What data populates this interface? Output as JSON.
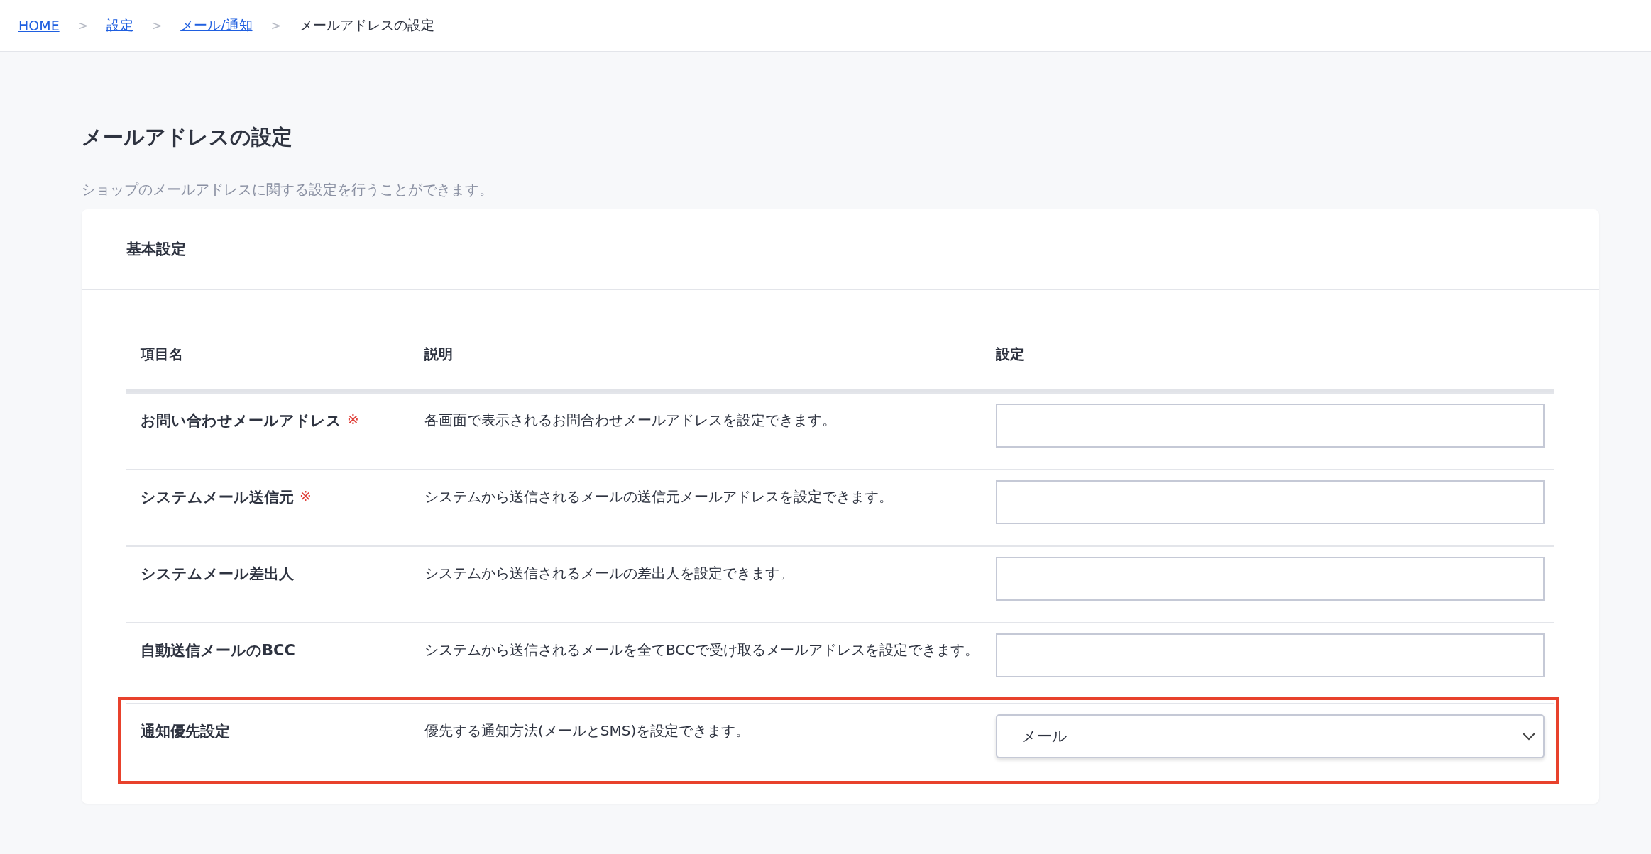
{
  "breadcrumb": [
    {
      "label": "HOME",
      "link": true
    },
    {
      "separator": ">",
      "label": "設定",
      "link": true
    },
    {
      "separator": ">",
      "label": "メール/通知",
      "link": true
    },
    {
      "separator": ">",
      "label": "メールアドレスの設定",
      "link": false
    }
  ],
  "page": {
    "title": "メールアドレスの設定",
    "description": "ショップのメールアドレスに関する設定を行うことができます。"
  },
  "card": {
    "title": "基本設定",
    "table": {
      "columns": [
        "項目名",
        "説明",
        "設定"
      ],
      "rows": [
        {
          "name": "お問い合わせメールアドレス",
          "required_mark": "※",
          "description": "各画面で表示されるお問合わせメールアドレスを設定できます。",
          "control": {
            "kind": "text"
          },
          "highlighted": false
        },
        {
          "name": "システムメール送信元",
          "required_mark": "※",
          "description": "システムから送信されるメールの送信元メールアドレスを設定できます。",
          "control": {
            "kind": "text"
          },
          "highlighted": false
        },
        {
          "name": "システムメール差出人",
          "description": "システムから送信されるメールの差出人を設定できます。",
          "control": {
            "kind": "text"
          },
          "highlighted": false
        },
        {
          "name": "自動送信メールのBCC",
          "description": "システムから送信されるメールを全てBCCで受け取るメールアドレスを設定できます。",
          "control": {
            "kind": "text"
          },
          "highlighted": false
        },
        {
          "name": "通知優先設定",
          "description": "優先する通知方法(メールとSMS)を設定できます。",
          "control": {
            "kind": "select",
            "value": "メール"
          },
          "highlighted": true
        }
      ]
    }
  }
}
